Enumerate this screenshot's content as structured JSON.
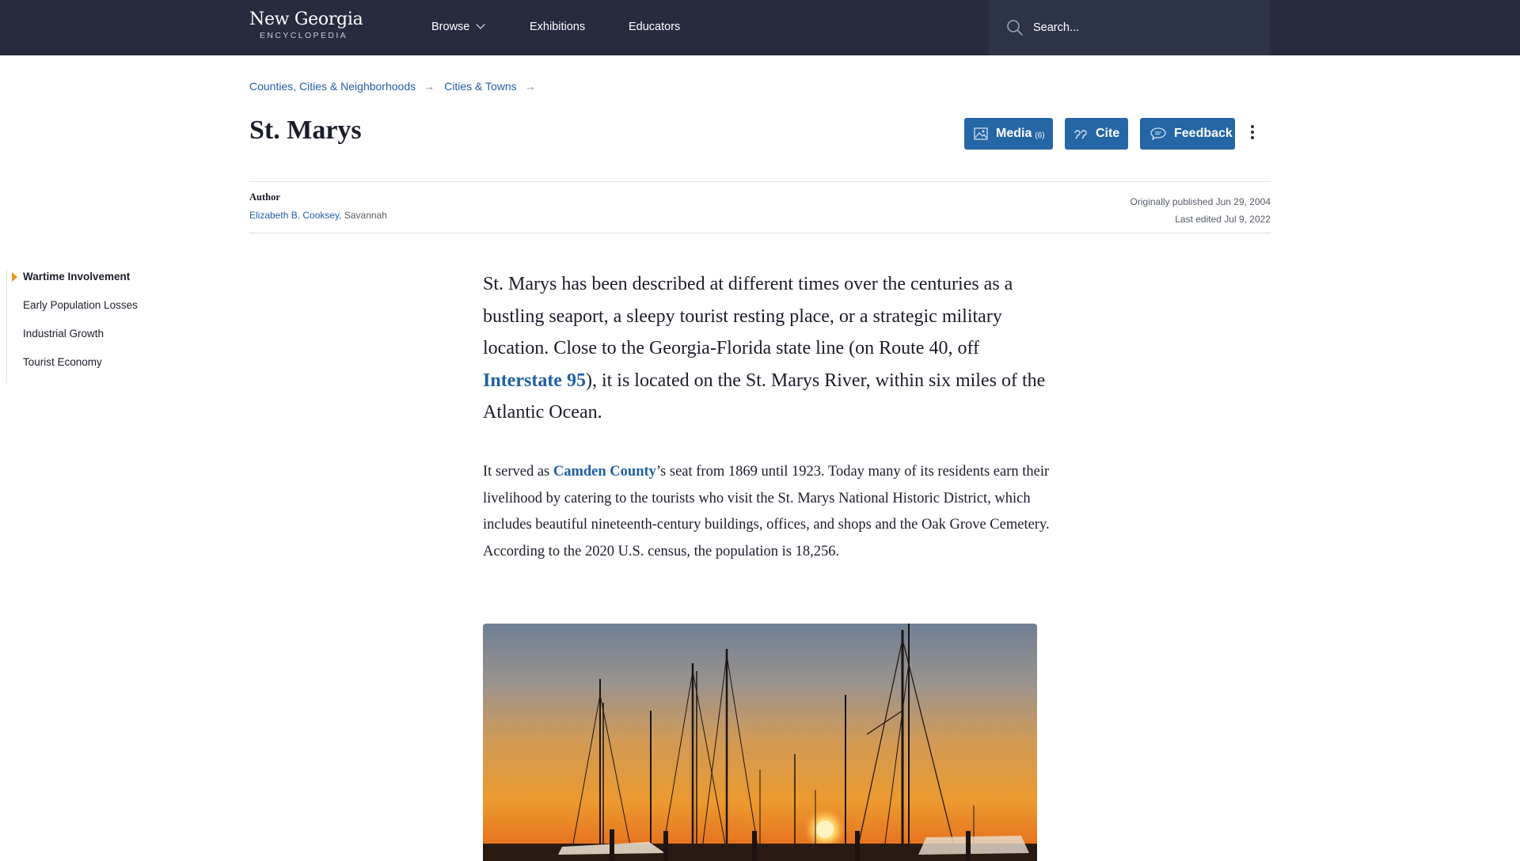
{
  "site": {
    "title": "New Georgia",
    "subtitle": "ENCYCLOPEDIA"
  },
  "nav": {
    "browse": "Browse",
    "exhibitions": "Exhibitions",
    "educators": "Educators",
    "search_placeholder": "Search..."
  },
  "breadcrumb": [
    "Counties, Cities & Neighborhoods",
    "Cities & Towns"
  ],
  "page": {
    "title": "St. Marys"
  },
  "actions": {
    "media_label": "Media",
    "media_count": "(6)",
    "cite_label": "Cite",
    "feedback_label": "Feedback"
  },
  "meta": {
    "author_heading": "Author",
    "author_name": "Elizabeth B. Cooksey",
    "author_location": ", Savannah",
    "published": "Originally published Jun 29, 2004",
    "edited": "Last edited Jul 9, 2022"
  },
  "toc": [
    "Wartime Involvement",
    "Early Population Losses",
    "Industrial Growth",
    "Tourist Economy"
  ],
  "article": {
    "lead_1": "St. Marys has been described at different times over the centuries as a bustling seaport, a sleepy tourist resting place, or a strategic military location. Close to the Georgia-Florida state line (on Route 40, off ",
    "lead_link": "Interstate 95",
    "lead_2": "), it is located on the St. Marys River, within six miles of the Atlantic Ocean.",
    "p1_1": "It served as ",
    "p1_link": "Camden County",
    "p1_2": "’s seat from 1869 until 1923. Today many of its residents earn their livelihood by catering to the tourists who visit the St. Marys National Historic District, which includes beautiful nineteenth-century buildings, offices, and shops and the Oak Grove Cemetery. According to the 2020 U.S. census, the population is 18,256."
  },
  "colors": {
    "nav_bg": "#262b3d",
    "link": "#1f5fa6",
    "button": "#2566a6",
    "toc_marker": "#e8931f"
  }
}
